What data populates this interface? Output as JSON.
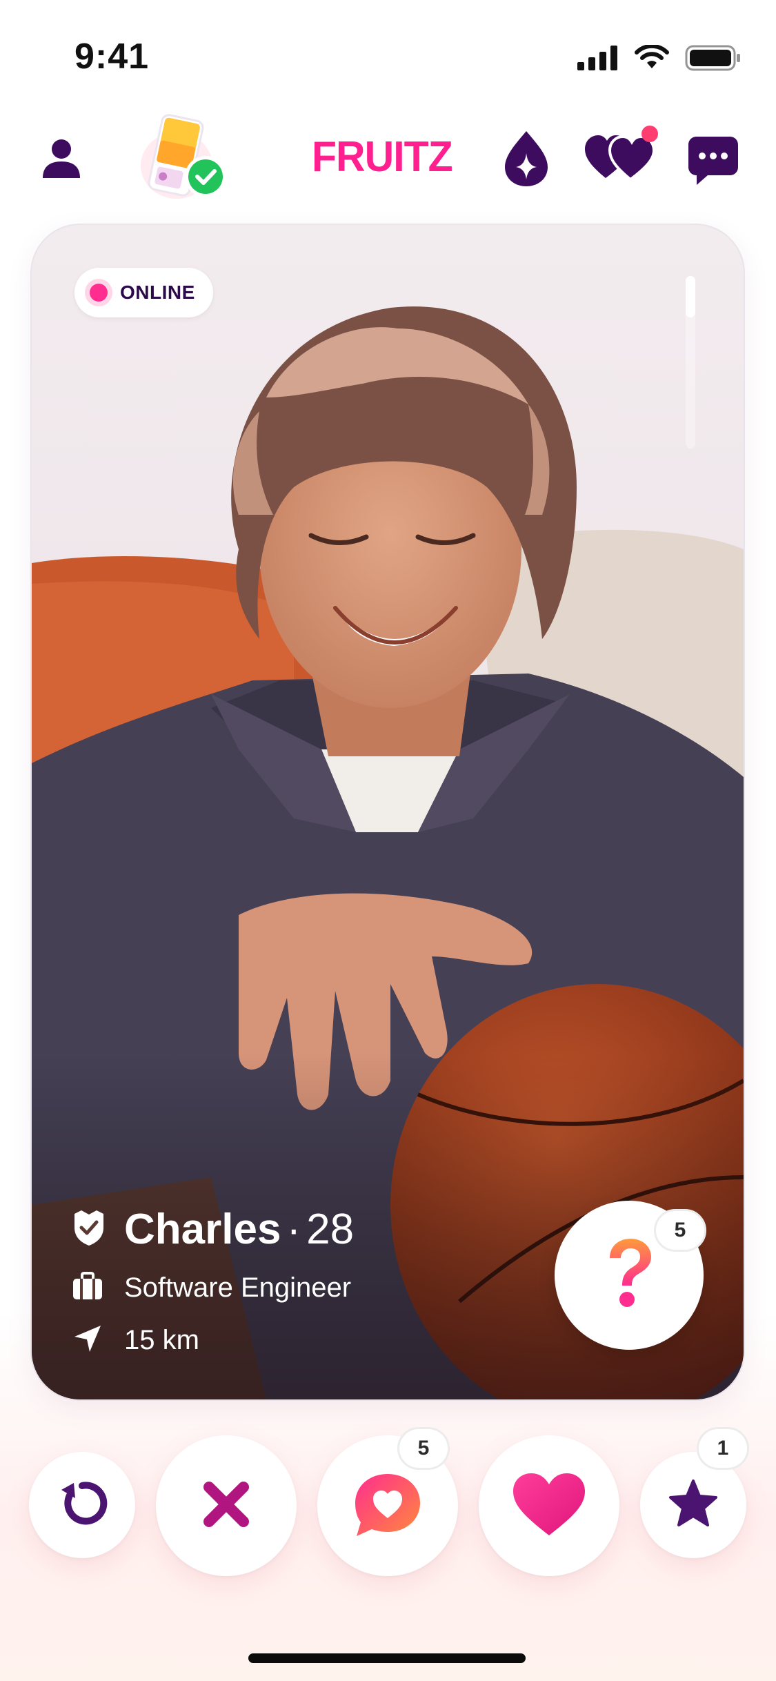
{
  "status_bar": {
    "time": "9:41",
    "icons": [
      "cellular-signal-icon",
      "wifi-icon",
      "battery-icon"
    ]
  },
  "header": {
    "brand": "FRUITZ",
    "icons": {
      "profile": "person-icon",
      "verification": "verified-fruit-icon",
      "boost": "sparkle-drop-icon",
      "likes": "double-heart-icon",
      "messages": "chat-bubble-icon"
    },
    "likes_has_notification": true
  },
  "profile_card": {
    "status": "ONLINE",
    "name": "Charles",
    "separator": "·",
    "age": "28",
    "job": "Software Engineer",
    "distance": "15 km",
    "question_count": "5",
    "icons": {
      "verified": "shield-check-icon",
      "job": "briefcase-icon",
      "distance": "location-arrow-icon",
      "question": "question-mark-icon"
    }
  },
  "actions": [
    {
      "id": "rewind",
      "icon": "rewind-icon"
    },
    {
      "id": "pass",
      "icon": "x-icon"
    },
    {
      "id": "message-like",
      "icon": "heart-bubble-icon",
      "count": "5"
    },
    {
      "id": "like",
      "icon": "heart-icon"
    },
    {
      "id": "super-like",
      "icon": "star-icon",
      "count": "1"
    }
  ],
  "colors": {
    "brand_pink": "#ff1f8e",
    "deep_purple": "#3d0c5e",
    "online_dot": "#ff2d8f"
  }
}
